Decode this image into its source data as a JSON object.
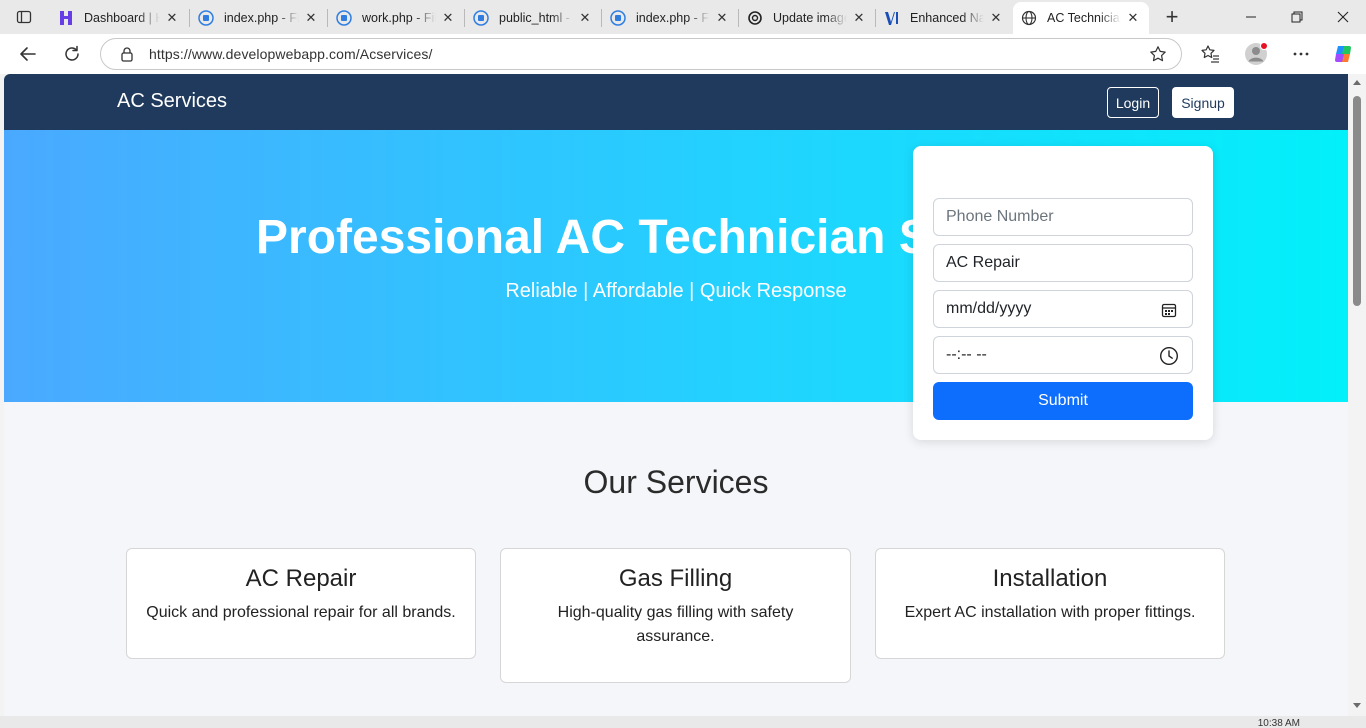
{
  "browser": {
    "tabs": [
      {
        "title": "Dashboard | H",
        "icon": "hostinger-icon",
        "active": false
      },
      {
        "title": "index.php - Fil",
        "icon": "file-manager-icon",
        "active": false
      },
      {
        "title": "work.php - Fil",
        "icon": "file-manager-icon",
        "active": false
      },
      {
        "title": "public_html - ",
        "icon": "file-manager-icon",
        "active": false
      },
      {
        "title": "index.php - Fil",
        "icon": "file-manager-icon",
        "active": false
      },
      {
        "title": "Update image",
        "icon": "chatgpt-icon",
        "active": false
      },
      {
        "title": "Enhanced Nav",
        "icon": "v-logo-icon",
        "active": false
      },
      {
        "title": "AC Technician",
        "icon": "globe-icon",
        "active": true
      }
    ],
    "url": "https://www.developwebapp.com/Acservices/",
    "clock": "10:38 AM"
  },
  "site": {
    "brand": "AC Services",
    "login_label": "Login",
    "signup_label": "Signup",
    "hero": {
      "title": "Professional AC Technician Services",
      "subtitle": "Reliable | Affordable | Quick Response"
    },
    "form": {
      "phone_placeholder": "Phone Number",
      "service_value": "AC Repair",
      "date_placeholder": "mm/dd/yyyy",
      "time_placeholder": "--:-- --",
      "submit_label": "Submit"
    },
    "services_heading": "Our Services",
    "services": [
      {
        "title": "AC Repair",
        "desc": "Quick and professional repair for all brands."
      },
      {
        "title": "Gas Filling",
        "desc": "High-quality gas filling with safety assurance."
      },
      {
        "title": "Installation",
        "desc": "Expert AC installation with proper fittings."
      }
    ]
  },
  "colors": {
    "navbar": "#1f3a5c",
    "hero_start": "#4aa9ff",
    "hero_end": "#02f0fa",
    "primary_button": "#0d6efd"
  }
}
